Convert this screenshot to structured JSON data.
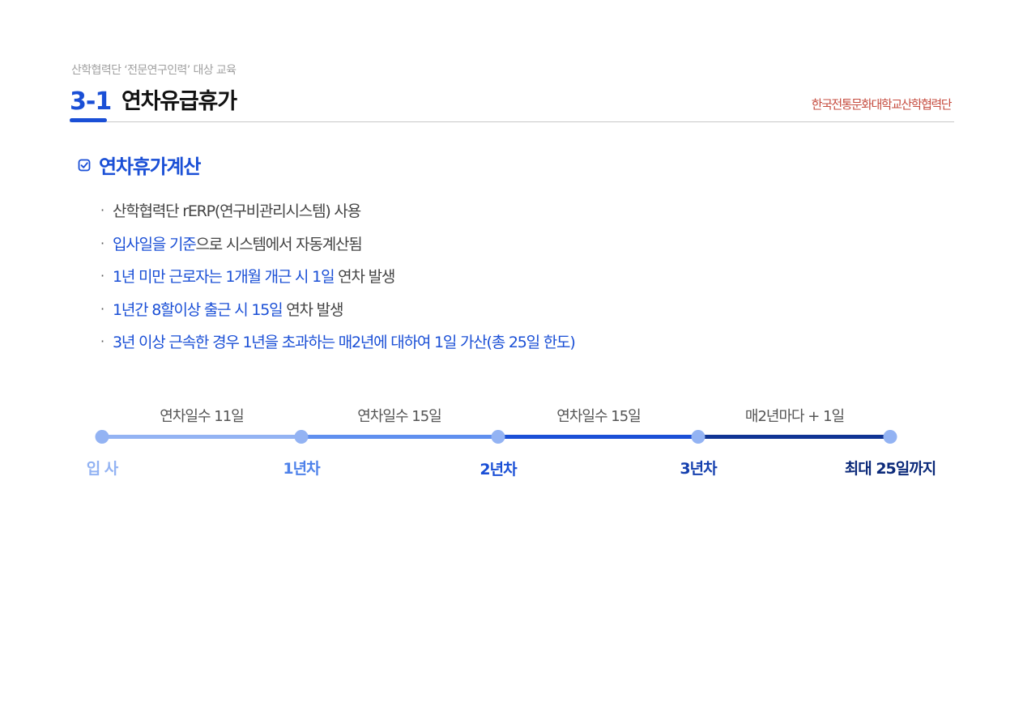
{
  "subtitle": "산학협력단 ‘전문연구인력’ 대상 교육",
  "section": {
    "number": "3-1",
    "title": "연차유급휴가"
  },
  "org_logo_text": "한국전통문화대학교산학협력단",
  "calc_section": {
    "heading": "연차휴가계산",
    "icon": "checkbox-checked-icon"
  },
  "bullets": [
    {
      "segments": [
        {
          "text": "산학협력단 rERP(연구비관리시스템) 사용",
          "color": "gray"
        }
      ]
    },
    {
      "segments": [
        {
          "text": "입사일을 기준",
          "color": "blue"
        },
        {
          "text": "으로 시스템에서 자동계산됨",
          "color": "gray"
        }
      ]
    },
    {
      "segments": [
        {
          "text": "1년 미만 근로자는 1개월 개근 시 1일",
          "color": "blue"
        },
        {
          "text": " 연차 발생",
          "color": "gray"
        }
      ]
    },
    {
      "segments": [
        {
          "text": "1년간 8할이상 출근 시 15일",
          "color": "blue"
        },
        {
          "text": " 연차 발생",
          "color": "gray"
        }
      ]
    },
    {
      "segments": [
        {
          "text": "3년 이상 근속한 경우 1년을 초과하는 매2년에 대하여 1일 가산(총 25일 한도)",
          "color": "blue"
        }
      ]
    }
  ],
  "timeline": {
    "milestones": [
      {
        "label": "입 사",
        "color": "#93b3f3"
      },
      {
        "label": "1년차",
        "color": "#4f82ea"
      },
      {
        "label": "2년차",
        "color": "#1a4fd6"
      },
      {
        "label": "3년차",
        "color": "#143fae"
      },
      {
        "label": "최대 25일까지",
        "color": "#0c2a7a"
      }
    ],
    "segments": [
      {
        "label": "연차일수 11일",
        "color": "#93b3f3"
      },
      {
        "label": "연차일수 15일",
        "color": "#5f8fef"
      },
      {
        "label": "연차일수 15일",
        "color": "#1a4fd6"
      },
      {
        "label": "매2년마다 + 1일",
        "color": "#0f3494"
      }
    ]
  },
  "colors": {
    "accent_blue": "#1a4fd6",
    "text_gray": "#444444",
    "logo_red": "#c0392b"
  }
}
